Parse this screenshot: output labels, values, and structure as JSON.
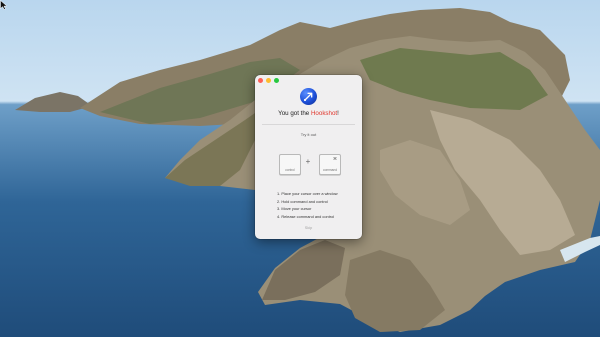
{
  "window": {
    "headline_before": "You got the ",
    "headline_brand": "Hookshot",
    "headline_after": "!",
    "try_label": "Try it out",
    "keys": [
      {
        "symbol": "",
        "label": "control"
      },
      {
        "symbol": "⌘",
        "label": "command"
      }
    ],
    "plus": "+",
    "steps": [
      "1. Place your cursor over a window",
      "2. Hold command and control",
      "3. Move your cursor",
      "4. Release command and control"
    ],
    "skip_label": "Skip"
  },
  "icons": {
    "app": "hook-arrow-icon",
    "cursor": "mouse-pointer-icon"
  },
  "colors": {
    "brand_highlight": "#e0352b",
    "app_icon": "#1d4fd8",
    "close": "#fe5f57",
    "minimize": "#febc2e",
    "maximize": "#28c840"
  }
}
